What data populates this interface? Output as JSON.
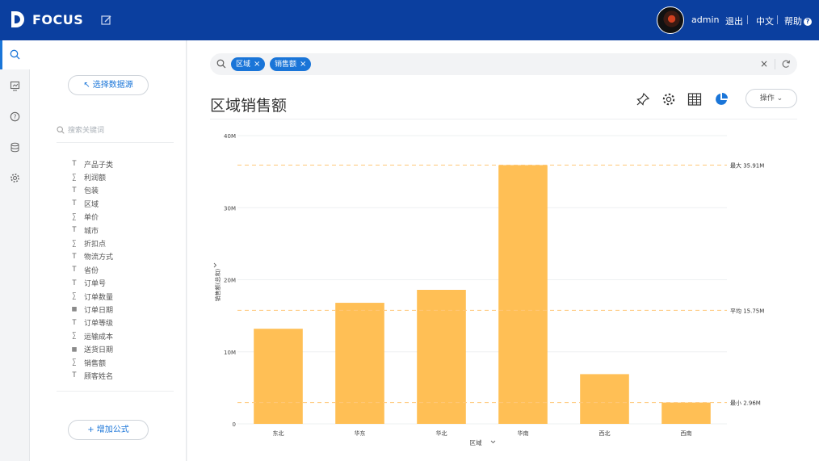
{
  "header": {
    "brand": "FOCUS",
    "user": "admin",
    "logout": "退出",
    "language": "中文",
    "help": "帮助"
  },
  "rail": {
    "items": [
      "search-icon",
      "dashboard-icon",
      "help-icon",
      "database-icon",
      "settings-icon"
    ],
    "active": "search-icon"
  },
  "panel": {
    "select_source_label": "选择数据源",
    "search_placeholder": "搜索关键词",
    "fields": [
      {
        "label": "产品子类",
        "type": "text"
      },
      {
        "label": "利润额",
        "type": "number"
      },
      {
        "label": "包装",
        "type": "text"
      },
      {
        "label": "区域",
        "type": "text"
      },
      {
        "label": "单价",
        "type": "number"
      },
      {
        "label": "城市",
        "type": "text"
      },
      {
        "label": "折扣点",
        "type": "number"
      },
      {
        "label": "物流方式",
        "type": "text"
      },
      {
        "label": "省份",
        "type": "text"
      },
      {
        "label": "订单号",
        "type": "text"
      },
      {
        "label": "订单数量",
        "type": "number"
      },
      {
        "label": "订单日期",
        "type": "date"
      },
      {
        "label": "订单等级",
        "type": "text"
      },
      {
        "label": "运输成本",
        "type": "number"
      },
      {
        "label": "送货日期",
        "type": "date"
      },
      {
        "label": "销售额",
        "type": "number"
      },
      {
        "label": "顾客姓名",
        "type": "text"
      }
    ],
    "add_formula_label": "增加公式"
  },
  "search": {
    "chips": [
      "区域",
      "销售额"
    ]
  },
  "main": {
    "title": "区域销售额",
    "operations_label": "操作"
  },
  "colors": {
    "brand": "#0b3f9f",
    "accent": "#1a75d8",
    "bar": "#ffbf55",
    "reference": "#ffc878"
  },
  "chart_data": {
    "type": "bar",
    "xlabel": "区域",
    "ylabel": "销售额(总和)",
    "categories": [
      "东北",
      "华东",
      "华北",
      "华南",
      "西北",
      "西南"
    ],
    "values": [
      13.2,
      16.8,
      18.6,
      35.91,
      6.9,
      2.96
    ],
    "value_unit": "M",
    "ylim": [
      0,
      40
    ],
    "yticks": [
      "0",
      "10M",
      "20M",
      "30M",
      "40M"
    ],
    "ytick_values": [
      0,
      10,
      20,
      30,
      40
    ],
    "grid": true,
    "reference_lines": [
      {
        "label": "最大 35.91M",
        "value": 35.91
      },
      {
        "label": "平均 15.75M",
        "value": 15.75
      },
      {
        "label": "最小 2.96M",
        "value": 2.96
      }
    ]
  }
}
